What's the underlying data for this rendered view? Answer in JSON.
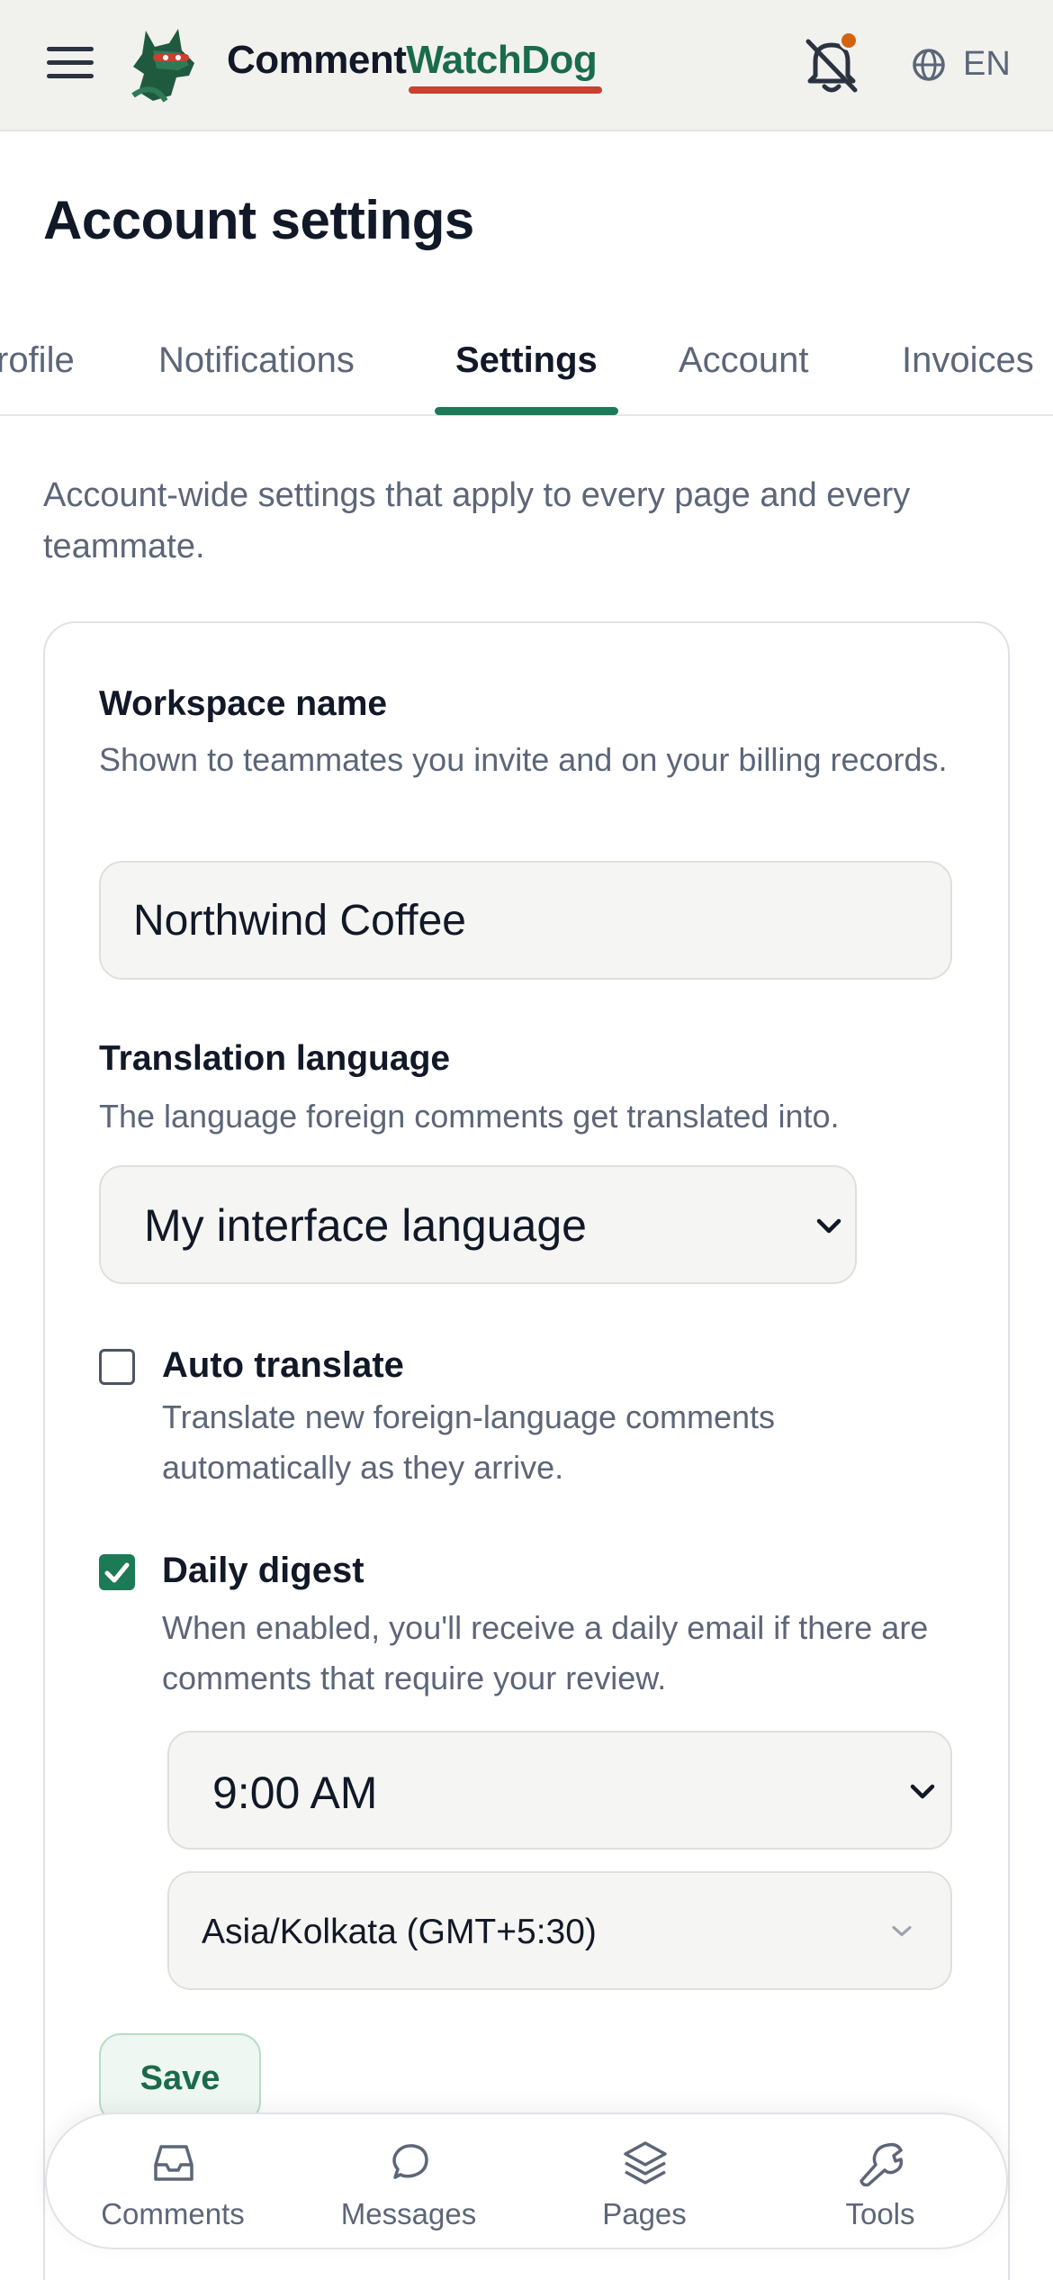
{
  "header": {
    "brand_part1": "Comment",
    "brand_part2": "WatchDog",
    "language": "EN",
    "icons": [
      "menu-icon",
      "dog-logo-icon",
      "bell-off-icon",
      "globe-icon"
    ],
    "colors": {
      "brand_green": "#1a6b4b",
      "underline_red": "#c9412f",
      "notification_dot": "#d4620e"
    }
  },
  "page": {
    "title": "Account settings",
    "intro": "Account-wide settings that apply to every page and every teammate."
  },
  "tabs": [
    {
      "label": "Profile",
      "visible_text": "rofile"
    },
    {
      "label": "Notifications"
    },
    {
      "label": "Settings",
      "active": true
    },
    {
      "label": "Account"
    },
    {
      "label": "Invoices"
    }
  ],
  "workspace": {
    "label": "Workspace name",
    "help": "Shown to teammates you invite and on your billing records.",
    "value": "Northwind Coffee"
  },
  "translation": {
    "label": "Translation language",
    "help": "The language foreign comments get translated into.",
    "selected": "My interface language"
  },
  "auto_translate": {
    "label": "Auto translate",
    "help": "Translate new foreign-language comments automatically as they arrive.",
    "checked": false
  },
  "daily_digest": {
    "label": "Daily digest",
    "help": "When enabled, you'll receive a daily email if there are comments that require your review.",
    "checked": true,
    "time": "9:00 AM",
    "timezone": "Asia/Kolkata (GMT+5:30)"
  },
  "actions": {
    "save": "Save"
  },
  "bottom_nav": [
    {
      "label": "Comments",
      "icon": "inbox-icon"
    },
    {
      "label": "Messages",
      "icon": "chat-bubble-icon"
    },
    {
      "label": "Pages",
      "icon": "layers-icon"
    },
    {
      "label": "Tools",
      "icon": "wrench-icon"
    }
  ],
  "accent": "#1d7a56"
}
